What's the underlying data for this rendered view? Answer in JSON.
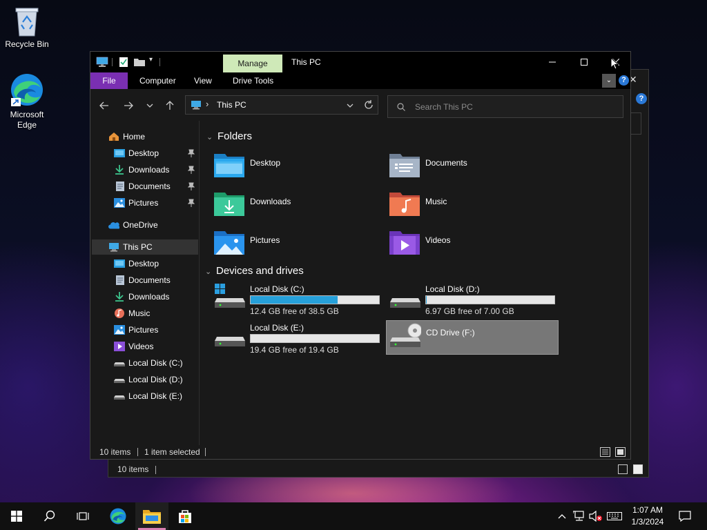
{
  "desktop": {
    "icons": [
      {
        "label": "Recycle Bin"
      },
      {
        "label": "Microsoft\nEdge"
      }
    ]
  },
  "window": {
    "title": "This PC",
    "contextual_tab": "Manage",
    "ribbon_tabs": [
      "File",
      "Computer",
      "View",
      "Drive Tools"
    ],
    "address": {
      "location": "This PC",
      "separator": "›"
    },
    "search": {
      "placeholder": "Search This PC"
    }
  },
  "nav_pane": {
    "quick_access": [
      {
        "label": "Home",
        "icon": "home-icon"
      },
      {
        "label": "Desktop",
        "icon": "desktop-folder-icon",
        "pinned": true
      },
      {
        "label": "Downloads",
        "icon": "downloads-icon",
        "pinned": true
      },
      {
        "label": "Documents",
        "icon": "documents-icon",
        "pinned": true
      },
      {
        "label": "Pictures",
        "icon": "pictures-icon",
        "pinned": true
      }
    ],
    "onedrive": {
      "label": "OneDrive",
      "icon": "onedrive-icon"
    },
    "this_pc": {
      "label": "This PC",
      "icon": "this-pc-icon"
    },
    "this_pc_children": [
      {
        "label": "Desktop",
        "icon": "desktop-folder-icon"
      },
      {
        "label": "Documents",
        "icon": "documents-icon"
      },
      {
        "label": "Downloads",
        "icon": "downloads-icon"
      },
      {
        "label": "Music",
        "icon": "music-icon"
      },
      {
        "label": "Pictures",
        "icon": "pictures-icon"
      },
      {
        "label": "Videos",
        "icon": "videos-icon"
      },
      {
        "label": "Local Disk (C:)",
        "icon": "drive-icon"
      },
      {
        "label": "Local Disk (D:)",
        "icon": "drive-icon"
      },
      {
        "label": "Local Disk (E:)",
        "icon": "drive-icon"
      }
    ]
  },
  "content": {
    "folders_header": "Folders",
    "folders": [
      "Desktop",
      "Documents",
      "Downloads",
      "Music",
      "Pictures",
      "Videos"
    ],
    "drives_header": "Devices and drives",
    "drives": [
      {
        "name": "Local Disk (C:)",
        "free": "12.4 GB free of 38.5 GB",
        "used_fraction": 0.68
      },
      {
        "name": "Local Disk (D:)",
        "free": "6.97 GB free of 7.00 GB",
        "used_fraction": 0.004
      },
      {
        "name": "Local Disk (E:)",
        "free": "19.4 GB free of 19.4 GB",
        "used_fraction": 0.0
      },
      {
        "name": "CD Drive (F:)",
        "free": "",
        "selected": true
      }
    ]
  },
  "status": {
    "items": "10 items",
    "selected": "1 item selected"
  },
  "ghost_status": {
    "items": "10 items"
  },
  "taskbar": {
    "clock_time": "1:07 AM",
    "clock_date": "1/3/2024"
  },
  "colors": {
    "accent_file_tab": "#7a2fb2",
    "manage_tab": "#cfe9b8",
    "progress_fill": "#26a0da"
  }
}
